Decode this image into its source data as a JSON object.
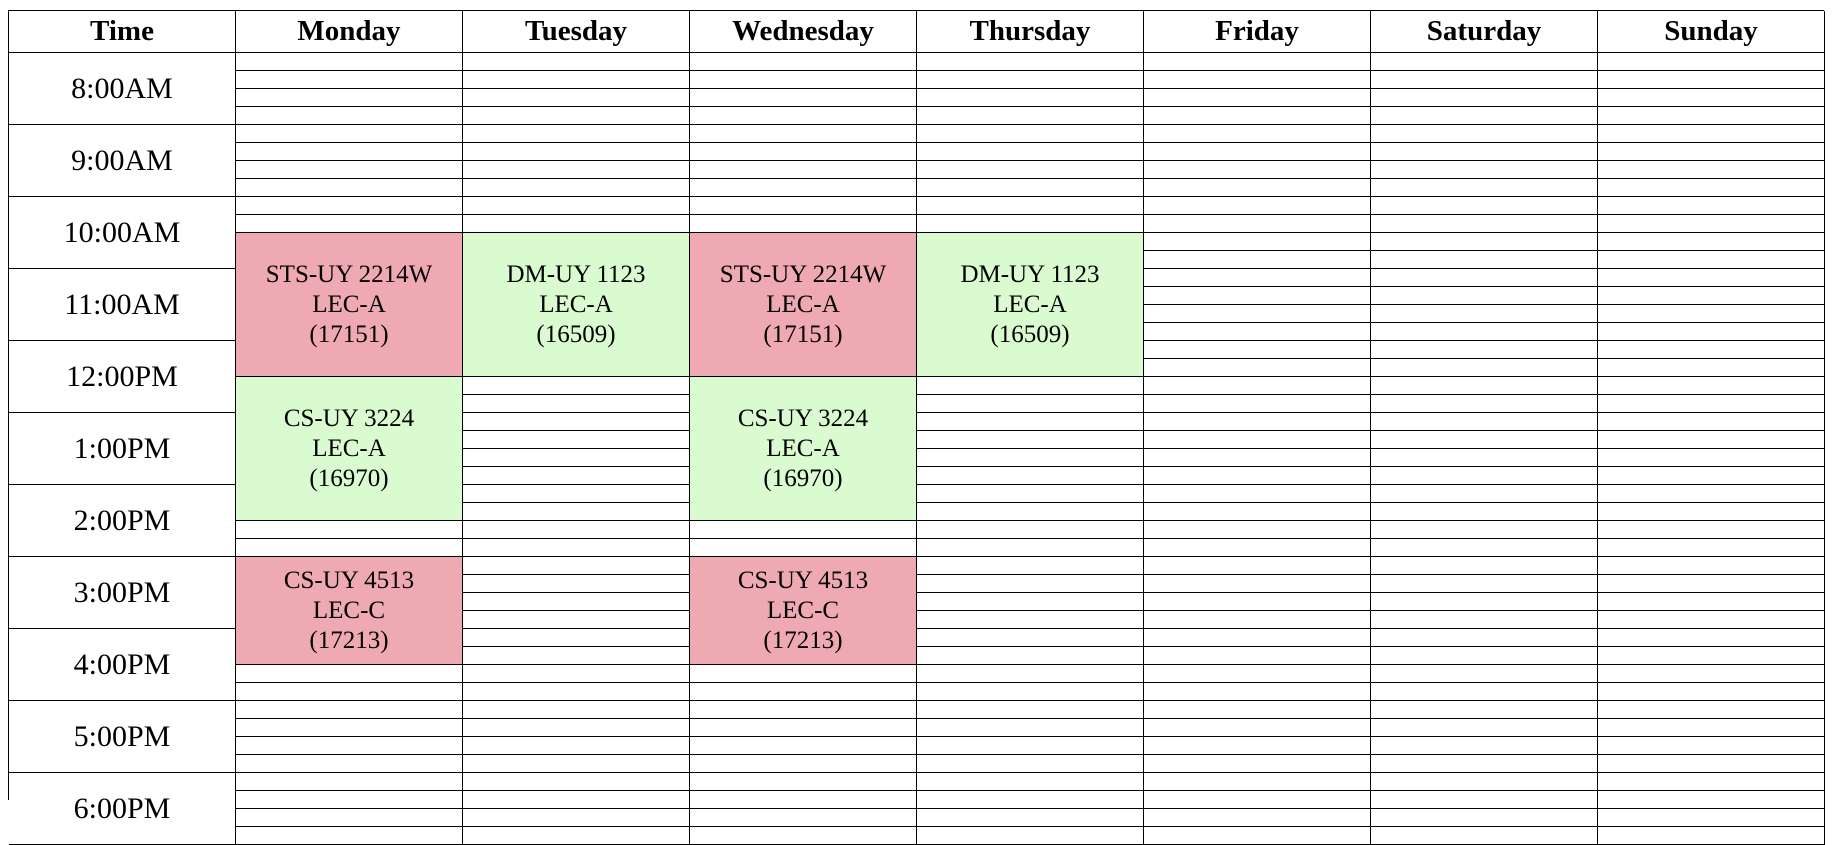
{
  "schedule": {
    "time_header": "Time",
    "days": [
      "Monday",
      "Tuesday",
      "Wednesday",
      "Thursday",
      "Friday",
      "Saturday",
      "Sunday"
    ],
    "times": [
      "8:00AM",
      "9:00AM",
      "10:00AM",
      "11:00AM",
      "12:00PM",
      "1:00PM",
      "2:00PM",
      "3:00PM",
      "4:00PM",
      "5:00PM",
      "6:00PM"
    ],
    "start_time": "8:00AM",
    "slot_minutes": 15,
    "colors": {
      "pink": "#efa9b3",
      "green": "#dafad0",
      "grid": "#000000"
    },
    "courses": [
      {
        "day": "Monday",
        "start": "10:30AM",
        "end": "12:30PM",
        "code": "STS-UY 2214W",
        "section": "LEC-A",
        "crn": "(17151)",
        "color": "pink"
      },
      {
        "day": "Wednesday",
        "start": "10:30AM",
        "end": "12:30PM",
        "code": "STS-UY 2214W",
        "section": "LEC-A",
        "crn": "(17151)",
        "color": "pink"
      },
      {
        "day": "Tuesday",
        "start": "10:30AM",
        "end": "12:30PM",
        "code": "DM-UY 1123",
        "section": "LEC-A",
        "crn": "(16509)",
        "color": "green"
      },
      {
        "day": "Thursday",
        "start": "10:30AM",
        "end": "12:30PM",
        "code": "DM-UY 1123",
        "section": "LEC-A",
        "crn": "(16509)",
        "color": "green"
      },
      {
        "day": "Monday",
        "start": "12:30PM",
        "end": "2:30PM",
        "code": "CS-UY 3224",
        "section": "LEC-A",
        "crn": "(16970)",
        "color": "green"
      },
      {
        "day": "Wednesday",
        "start": "12:30PM",
        "end": "2:30PM",
        "code": "CS-UY 3224",
        "section": "LEC-A",
        "crn": "(16970)",
        "color": "green"
      },
      {
        "day": "Monday",
        "start": "3:00PM",
        "end": "4:30PM",
        "code": "CS-UY 4513",
        "section": "LEC-C",
        "crn": "(17213)",
        "color": "pink"
      },
      {
        "day": "Wednesday",
        "start": "3:00PM",
        "end": "4:30PM",
        "code": "CS-UY 4513",
        "section": "LEC-C",
        "crn": "(17213)",
        "color": "pink"
      }
    ]
  }
}
